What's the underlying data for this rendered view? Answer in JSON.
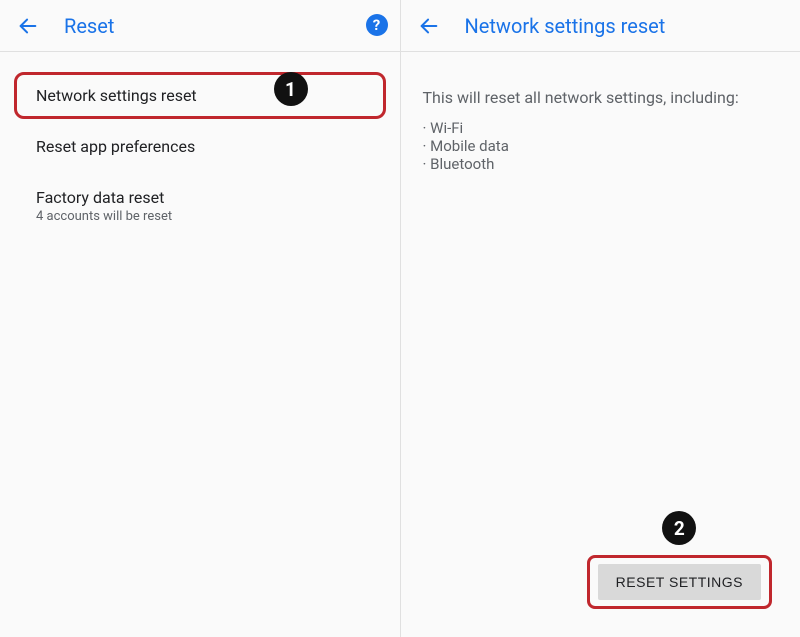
{
  "left": {
    "header_title": "Reset",
    "items": [
      {
        "title": "Network settings reset",
        "subtitle": ""
      },
      {
        "title": "Reset app preferences",
        "subtitle": ""
      },
      {
        "title": "Factory data reset",
        "subtitle": "4 accounts will be reset"
      }
    ]
  },
  "right": {
    "header_title": "Network settings reset",
    "description": "This will reset all network settings, including:",
    "bullets": [
      "Wi-Fi",
      "Mobile data",
      "Bluetooth"
    ],
    "button_label": "RESET SETTINGS"
  },
  "callouts": {
    "one": "1",
    "two": "2"
  },
  "help_glyph": "?"
}
